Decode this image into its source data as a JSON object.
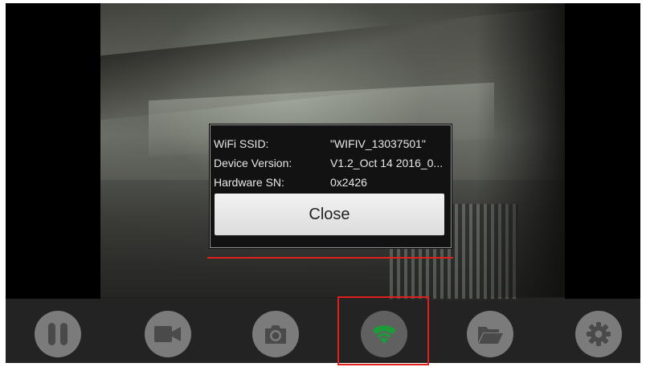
{
  "dialog": {
    "rows": [
      {
        "label": "WiFi SSID:",
        "value": "\"WIFIV_13037501\""
      },
      {
        "label": "Device Version:",
        "value": "V1.2_Oct 14 2016_0..."
      },
      {
        "label": "Hardware SN:",
        "value": "0x2426"
      }
    ],
    "close_label": "Close"
  },
  "toolbar": {
    "buttons": [
      {
        "icon": "pause-icon"
      },
      {
        "icon": "video-camera-icon"
      },
      {
        "icon": "camera-icon"
      },
      {
        "icon": "wifi-icon",
        "active": true
      },
      {
        "icon": "folder-icon"
      },
      {
        "icon": "gear-icon"
      }
    ]
  },
  "colors": {
    "wifi_active": "#1f9a3a",
    "highlight": "#e0201c",
    "icon_fill": "#4a4a4a"
  }
}
